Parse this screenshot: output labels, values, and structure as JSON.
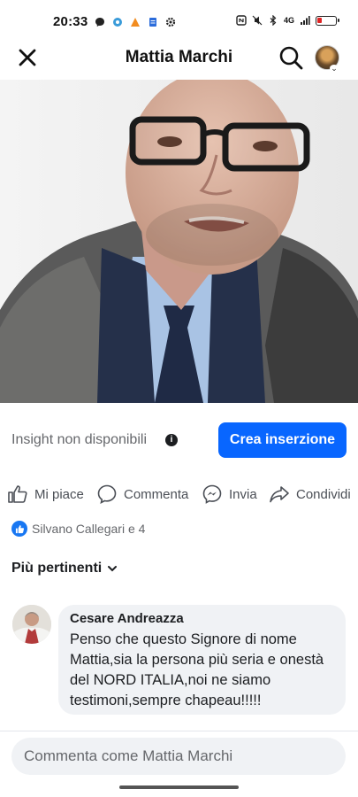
{
  "status_bar": {
    "time": "20:33",
    "signal_text": "4G",
    "battery_color": "#e02424"
  },
  "header": {
    "title": "Mattia Marchi",
    "close_icon": "close-icon",
    "search_icon": "search-icon"
  },
  "insights": {
    "label": "Insight non disponibili",
    "info_icon": "i",
    "ad_button": "Crea inserzione"
  },
  "actions": [
    {
      "label": "Mi piace",
      "icon": "like-icon"
    },
    {
      "label": "Commenta",
      "icon": "comment-icon"
    },
    {
      "label": "Invia",
      "icon": "messenger-icon"
    },
    {
      "label": "Condividi",
      "icon": "share-icon"
    }
  ],
  "reactions": {
    "text": "Silvano Callegari e 4"
  },
  "sort": {
    "label": "Più pertinenti"
  },
  "comment": {
    "author": "Cesare Andreazza",
    "text": "Penso che questo Signore di nome Mattia,sia la persona più seria e onestà del NORD ITALIA,noi ne siamo testimoni,sempre chapeau!!!!!"
  },
  "compose": {
    "placeholder": "Commenta come Mattia Marchi"
  },
  "colors": {
    "accent": "#0866ff",
    "like_badge": "#1877f2",
    "bubble": "#f0f2f5"
  }
}
